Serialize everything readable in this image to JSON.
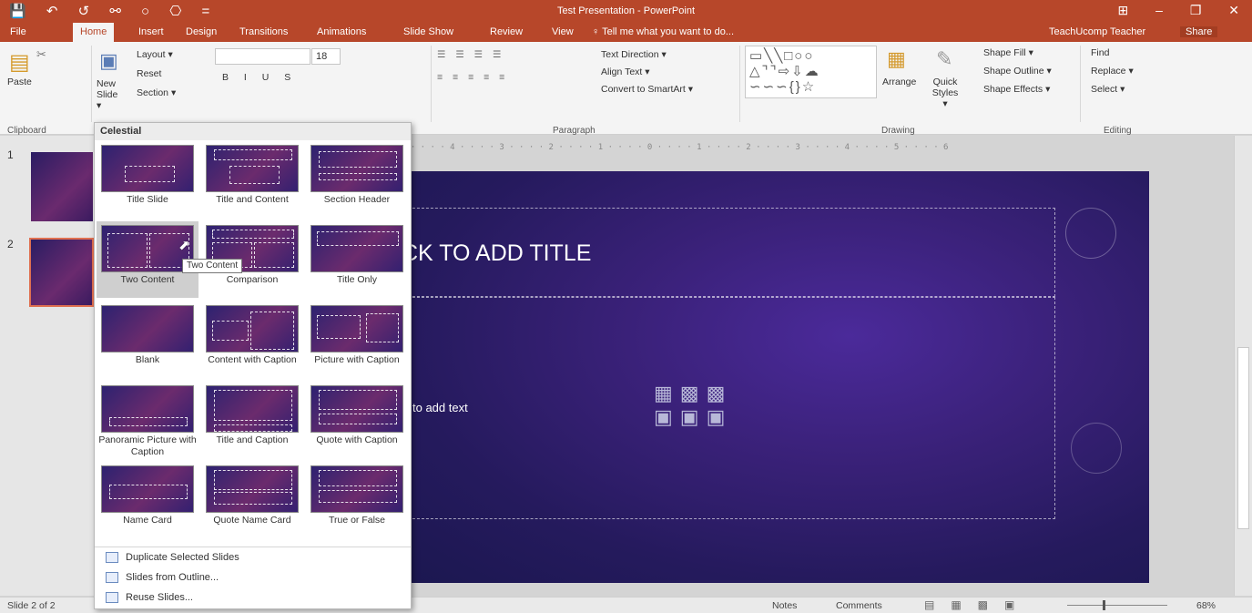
{
  "window": {
    "title": "Test Presentation - PowerPoint",
    "quick_access": "💾 ↶ ↺ ⚯ ○ ⎔ =",
    "controls": "⊞ – ❐ ✕"
  },
  "tabs": [
    "File",
    "Home",
    "Insert",
    "Design",
    "Transitions",
    "Animations",
    "Slide Show",
    "Review",
    "View"
  ],
  "tell_me": "♀ Tell me what you want to do...",
  "user": "TeachUcomp Teacher",
  "share": "Share",
  "ribbon": {
    "paste": "Paste",
    "new_slide": "New Slide ▾",
    "layout": "Layout ▾",
    "reset": "Reset",
    "section": "Section ▾",
    "font_size": "18",
    "text_direction": "Text Direction ▾",
    "align_text": "Align Text ▾",
    "convert_smartart": "Convert to SmartArt ▾",
    "arrange": "Arrange",
    "quick_styles": "Quick Styles ▾",
    "shape_fill": "Shape Fill ▾",
    "shape_outline": "Shape Outline ▾",
    "shape_effects": "Shape Effects ▾",
    "find": "Find",
    "replace": "Replace ▾",
    "select": "Select ▾",
    "groups": {
      "clipboard": "Clipboard",
      "paragraph": "Paragraph",
      "drawing": "Drawing",
      "editing": "Editing"
    }
  },
  "thumbnails": [
    {
      "num": "1"
    },
    {
      "num": "2"
    }
  ],
  "slide": {
    "title_text": "CK TO ADD TITLE",
    "body_text": "to add text"
  },
  "ruler_text": "5 · · · · 4 · · · · 3 · · · · 2 · · · · 1 · · · · 0 · · · · 1 · · · · 2 · · · · 3 · · · · 4 · · · · 5 · · · · 6",
  "gallery": {
    "heading": "Celestial",
    "layouts": [
      "Title Slide",
      "Title and Content",
      "Section Header",
      "Two Content",
      "Comparison",
      "Title Only",
      "Blank",
      "Content with Caption",
      "Picture with Caption",
      "Panoramic Picture with Caption",
      "Title and Caption",
      "Quote with Caption",
      "Name Card",
      "Quote Name Card",
      "True or False"
    ],
    "selected": "Two Content",
    "menu": [
      "Duplicate Selected Slides",
      "Slides from Outline...",
      "Reuse Slides..."
    ]
  },
  "tooltip": "Two Content",
  "status": {
    "slide_pos": "Slide 2 of 2",
    "notes": "Notes",
    "comments": "Comments",
    "zoom": "68%"
  }
}
